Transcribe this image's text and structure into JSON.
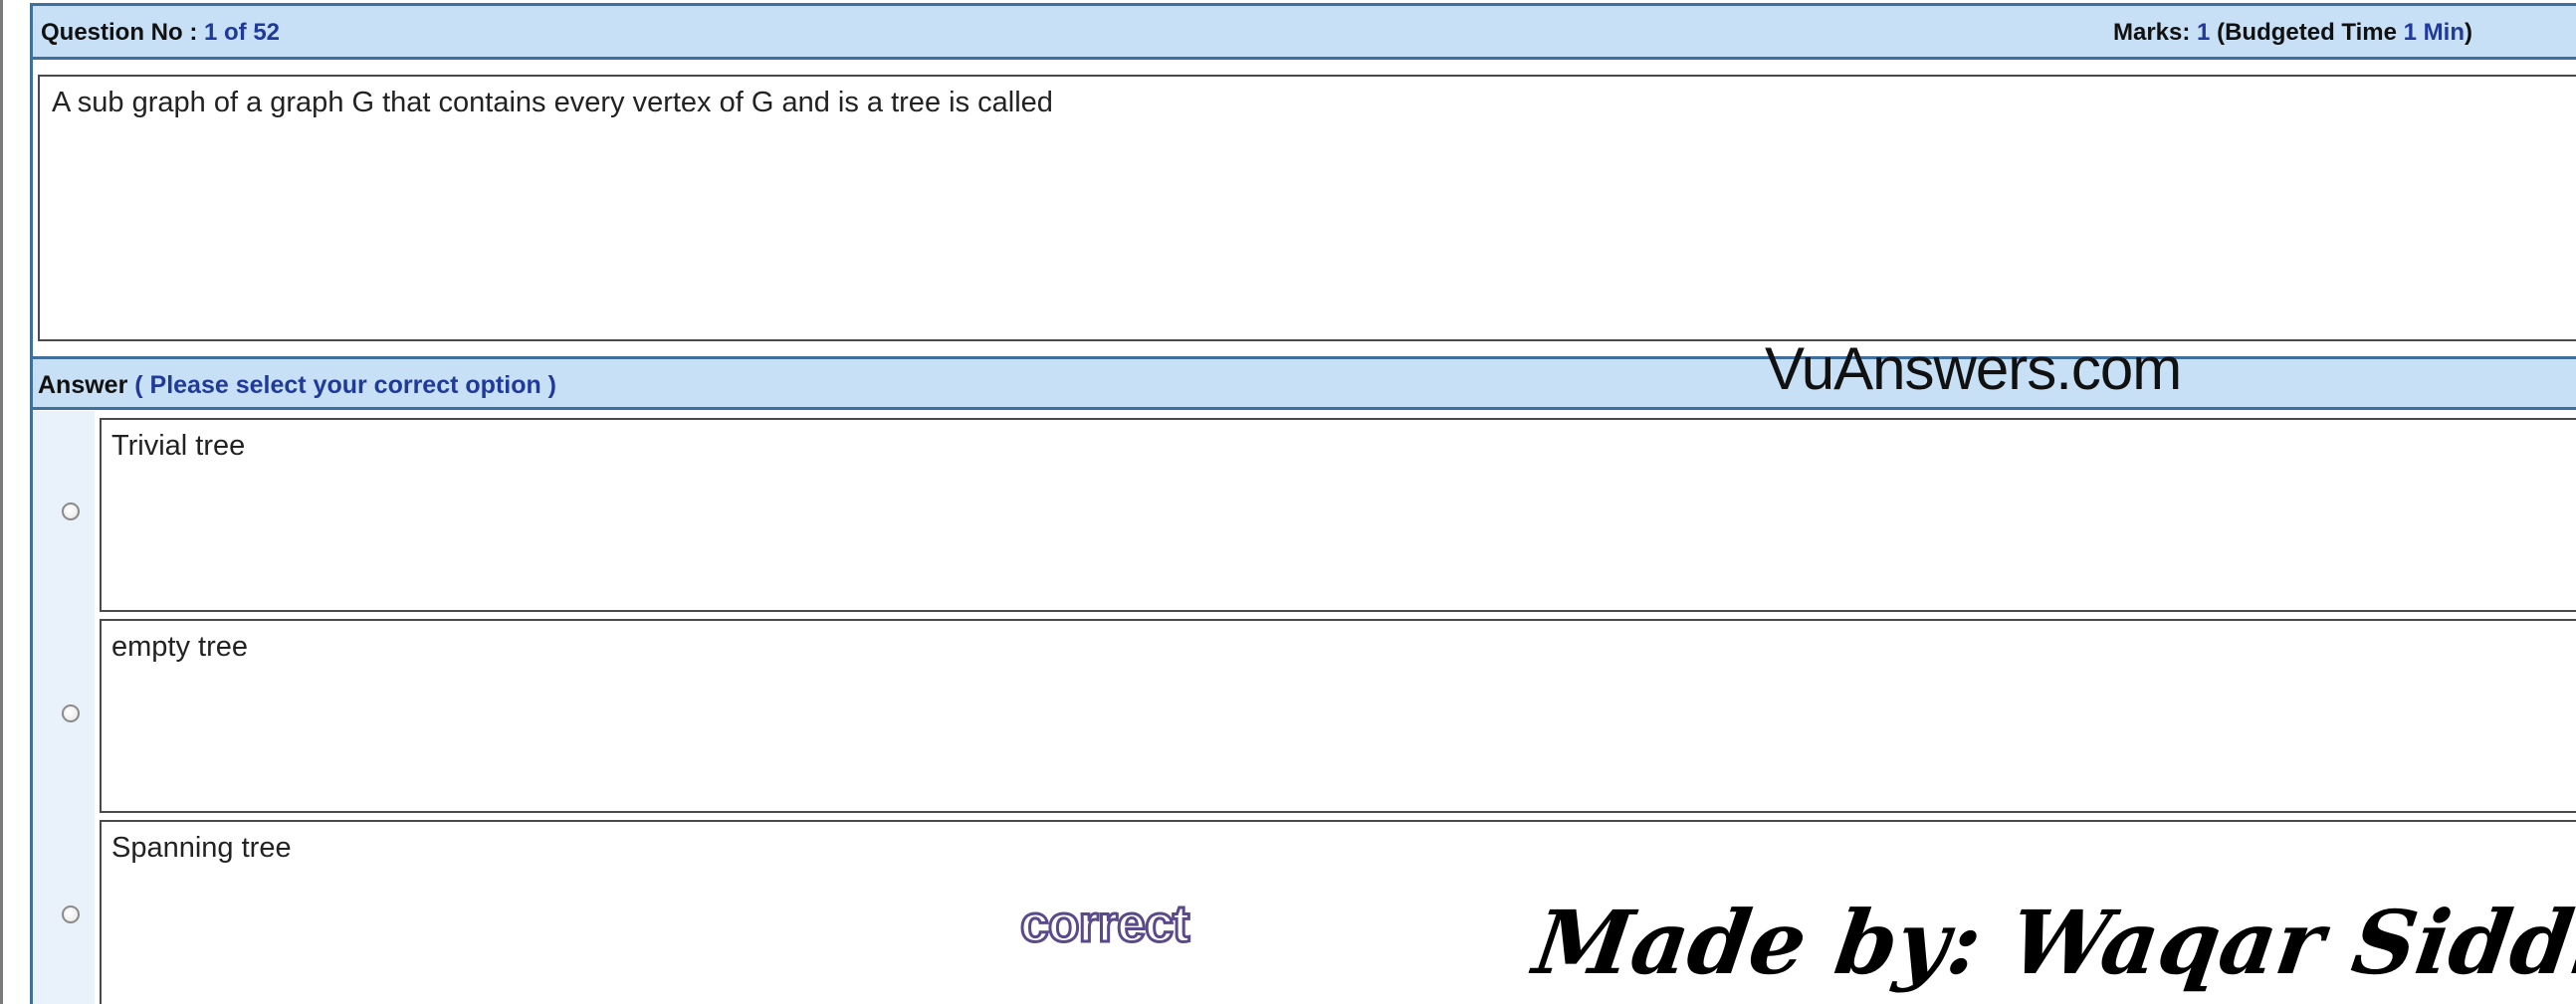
{
  "header": {
    "question_label": "Question No :",
    "question_number": "1 of 52",
    "marks_label": "Marks:",
    "marks_value": "1",
    "budget_open": "(Budgeted Time",
    "budget_value": "1 Min",
    "budget_close": ")"
  },
  "question": {
    "text": "A sub graph of a graph G that contains every vertex of G and is a tree is called"
  },
  "answer": {
    "label": "Answer",
    "instruction": "( Please select your correct option )"
  },
  "options": [
    {
      "label": "Trivial tree",
      "selected": false
    },
    {
      "label": "empty tree",
      "selected": false
    },
    {
      "label": "Spanning tree",
      "selected": false
    }
  ],
  "overlays": {
    "watermark": "VuAnswers.com",
    "correct_marker": "correct",
    "signature": "Made by: Waqar Siddhu"
  },
  "colors": {
    "header_bg": "#c8e0f6",
    "border_blue": "#3f6f9f",
    "label_blue": "#1f3a9a"
  }
}
